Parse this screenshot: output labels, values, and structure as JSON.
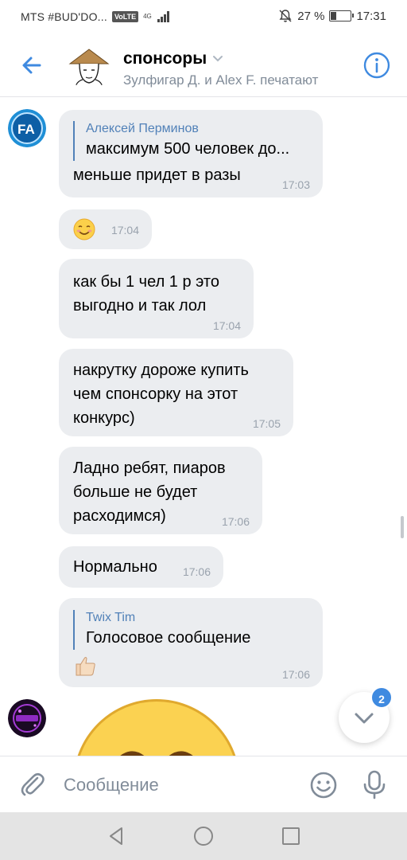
{
  "status_bar": {
    "carrier": "MTS #BUD'DO...",
    "volte": "VoLTE",
    "network": "4G",
    "battery_percent": "27 %",
    "battery_level": 0.27,
    "time": "17:31"
  },
  "header": {
    "title": "спонсоры",
    "subtitle": "Зулфигар Д. и Alex F. печатают"
  },
  "messages": [
    {
      "reply_author": "Алексей Перминов",
      "reply_text": "максимум 500 человек до...",
      "text": "меньше придет в разы",
      "time": "17:03"
    },
    {
      "emoji": "smiling-face",
      "time": "17:04"
    },
    {
      "text_lines": [
        "как бы 1 чел 1 р это",
        "выгодно и так лол"
      ],
      "time": "17:04"
    },
    {
      "text_lines": [
        "накрутку дороже купить",
        "чем спонсорку на этот",
        "конкурс)"
      ],
      "time": "17:05"
    },
    {
      "text_lines": [
        "Ладно ребят, пиаров",
        "больше не будет",
        "расходимся)"
      ],
      "time": "17:06"
    },
    {
      "text": "Нормально",
      "time": "17:06"
    },
    {
      "reply_author": "Twix Tim",
      "reply_text": "Голосовое сообщение",
      "emoji": "thumbs-up",
      "time": "17:06"
    }
  ],
  "unread_count": "2",
  "composer": {
    "placeholder": "Сообщение"
  },
  "colors": {
    "accent": "#3f8ae0",
    "bubble": "#ebedf0",
    "secondary_text": "#818c99",
    "reply_bar": "#5181b8",
    "nav_bar": "#e4e4e4"
  },
  "icons": [
    "back-arrow-icon",
    "chevron-down-icon",
    "info-icon",
    "paperclip-icon",
    "emoji-icon",
    "microphone-icon",
    "chevron-down-icon",
    "nav-back-icon",
    "nav-home-icon",
    "nav-recents-icon"
  ]
}
